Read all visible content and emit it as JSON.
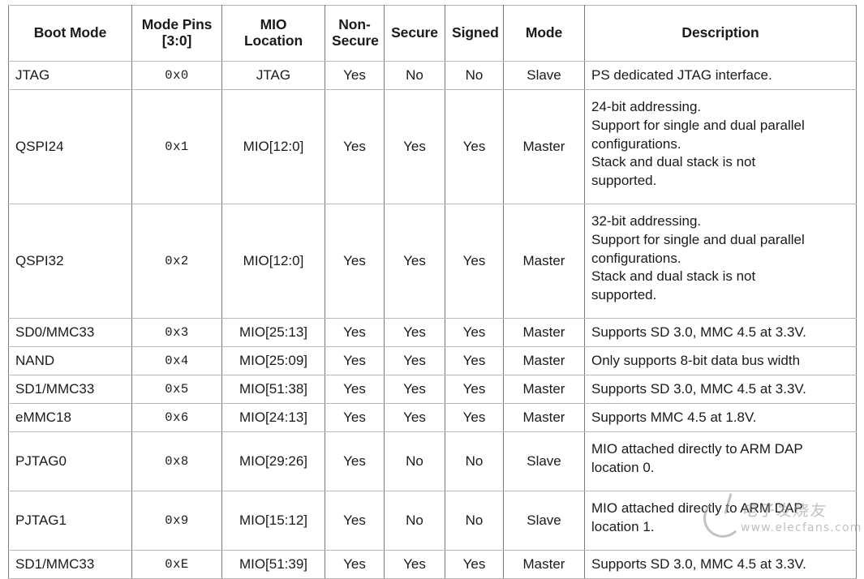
{
  "table": {
    "columns": [
      {
        "key": "boot_mode",
        "label_lines": [
          "Boot Mode"
        ]
      },
      {
        "key": "mode_pins",
        "label_lines": [
          "Mode Pins",
          "[3:0]"
        ]
      },
      {
        "key": "mio",
        "label_lines": [
          "MIO",
          "Location"
        ]
      },
      {
        "key": "non_secure",
        "label_lines": [
          "Non-",
          "Secure"
        ]
      },
      {
        "key": "secure",
        "label_lines": [
          "Secure"
        ]
      },
      {
        "key": "signed",
        "label_lines": [
          "Signed"
        ]
      },
      {
        "key": "mode",
        "label_lines": [
          "Mode"
        ]
      },
      {
        "key": "description",
        "label_lines": [
          "Description"
        ]
      }
    ],
    "header_rule_color": "#b02a4b",
    "grid_color": "#777777",
    "rows": [
      {
        "boot_mode": "JTAG",
        "mode_pins": "0x0",
        "mio": "JTAG",
        "non_secure": "Yes",
        "secure": "No",
        "signed": "No",
        "mode": "Slave",
        "description": [
          "PS dedicated JTAG interface."
        ]
      },
      {
        "boot_mode": "QSPI24",
        "mode_pins": "0x1",
        "mio": "MIO[12:0]",
        "non_secure": "Yes",
        "secure": "Yes",
        "signed": "Yes",
        "mode": "Master",
        "description": [
          "24-bit addressing.",
          "Support for single and dual parallel",
          "configurations.",
          "Stack and dual stack is not",
          "supported."
        ]
      },
      {
        "boot_mode": "QSPI32",
        "mode_pins": "0x2",
        "mio": "MIO[12:0]",
        "non_secure": "Yes",
        "secure": "Yes",
        "signed": "Yes",
        "mode": "Master",
        "description": [
          "32-bit addressing.",
          "Support for single and dual parallel",
          "configurations.",
          "Stack and dual stack is not",
          "supported."
        ]
      },
      {
        "boot_mode": "SD0/MMC33",
        "mode_pins": "0x3",
        "mio": "MIO[25:13]",
        "non_secure": "Yes",
        "secure": "Yes",
        "signed": "Yes",
        "mode": "Master",
        "description": [
          "Supports SD 3.0, MMC 4.5 at 3.3V."
        ]
      },
      {
        "boot_mode": "NAND",
        "mode_pins": "0x4",
        "mio": "MIO[25:09]",
        "non_secure": "Yes",
        "secure": "Yes",
        "signed": "Yes",
        "mode": "Master",
        "description": [
          "Only supports 8-bit data bus width"
        ]
      },
      {
        "boot_mode": "SD1/MMC33",
        "mode_pins": "0x5",
        "mio": "MIO[51:38]",
        "non_secure": "Yes",
        "secure": "Yes",
        "signed": "Yes",
        "mode": "Master",
        "description": [
          "Supports SD 3.0, MMC 4.5 at 3.3V."
        ]
      },
      {
        "boot_mode": "eMMC18",
        "mode_pins": "0x6",
        "mio": "MIO[24:13]",
        "non_secure": "Yes",
        "secure": "Yes",
        "signed": "Yes",
        "mode": "Master",
        "description": [
          "Supports MMC 4.5 at 1.8V."
        ]
      },
      {
        "boot_mode": "PJTAG0",
        "mode_pins": "0x8",
        "mio": "MIO[29:26]",
        "non_secure": "Yes",
        "secure": "No",
        "signed": "No",
        "mode": "Slave",
        "description": [
          "MIO attached directly to ARM DAP",
          "location 0."
        ]
      },
      {
        "boot_mode": "PJTAG1",
        "mode_pins": "0x9",
        "mio": "MIO[15:12]",
        "non_secure": "Yes",
        "secure": "No",
        "signed": "No",
        "mode": "Slave",
        "description": [
          "MIO attached directly to ARM DAP",
          "location 1."
        ]
      },
      {
        "boot_mode": "SD1/MMC33",
        "mode_pins": "0xE",
        "mio": "MIO[51:39]",
        "non_secure": "Yes",
        "secure": "Yes",
        "signed": "Yes",
        "mode": "Master",
        "description": [
          "Supports SD 3.0, MMC 4.5 at 3.3V."
        ]
      }
    ]
  },
  "watermark": {
    "chinese": "电子发烧友",
    "url": "www.elecfans.com"
  }
}
